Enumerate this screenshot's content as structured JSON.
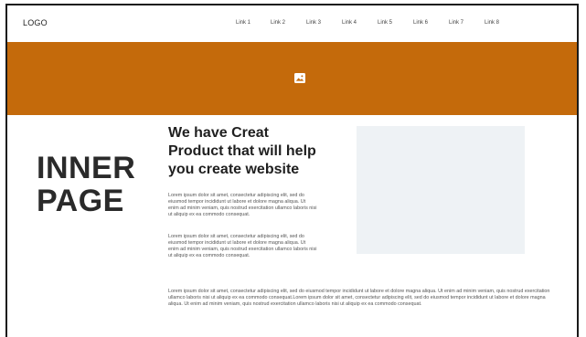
{
  "header": {
    "logo": "LOGO",
    "links": [
      "Link 1",
      "Link 2",
      "Link 3",
      "Link 4",
      "Link 5",
      "Link 6",
      "Link 7",
      "Link 8"
    ]
  },
  "banner": {
    "color": "#c46a0b",
    "icon": "image-icon"
  },
  "main": {
    "inner_title_line1": "INNER",
    "inner_title_line2": "PAGE",
    "headline": "We have Creat Product that will help you create website",
    "paragraph1": "Lorem ipsum dolor sit amet, consectetur adipiscing elit, sed do eiusmod tempor incididunt ut labore et dolore magna aliqua. Ut enim ad minim veniam, quis nostrud exercitation ullamco laboris nisi ut aliquip ex ea commodo consequat.",
    "paragraph2": "Lorem ipsum dolor sit amet, consectetur adipiscing elit, sed do eiusmod tempor incididunt ut labore et dolore magna aliqua. Ut enim ad minim veniam, quis nostrud exercitation ullamco laboris nisi ut aliquip ex ea commodo consequat.",
    "paragraph_wide": "Lorem ipsum dolor sit amet, consectetur adipiscing elit, sed do eiusmod tempor incididunt ut labore et dolore magna aliqua. Ut enim ad minim veniam, quis nostrud exercitation ullamco laboris nisi ut aliquip ex ea commodo consequat.Lorem ipsum dolor sit amet, consectetur adipiscing elit, sed do eiusmod tempor incididunt ut labore et dolore magna aliqua. Ut enim ad minim veniam, quis nostrud exercitation ullamco laboris nisi ut aliquip ex ea commodo consequat."
  }
}
